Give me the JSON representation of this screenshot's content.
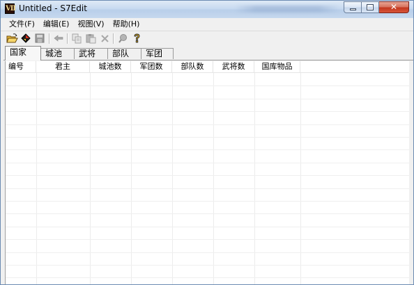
{
  "window": {
    "title": "Untitled - S7Edit",
    "app_icon_text": "VII",
    "close_glyph": "✕"
  },
  "menu": [
    {
      "label": "文件(F)"
    },
    {
      "label": "编辑(E)"
    },
    {
      "label": "视图(V)"
    },
    {
      "label": "帮助(H)"
    }
  ],
  "toolbar": {
    "buttons": [
      {
        "icon": "open-folder-icon",
        "enabled": true
      },
      {
        "icon": "diamond-tool-icon",
        "enabled": true
      },
      {
        "icon": "save-icon",
        "enabled": false
      },
      {
        "icon": "back-arrow-icon",
        "enabled": false
      },
      {
        "icon": "copy-icon",
        "enabled": false
      },
      {
        "icon": "paste-icon",
        "enabled": false
      },
      {
        "icon": "delete-icon",
        "enabled": false
      },
      {
        "icon": "search-icon",
        "enabled": false
      },
      {
        "icon": "help-icon",
        "enabled": true
      }
    ]
  },
  "tabs": [
    {
      "label": "国家",
      "active": true
    },
    {
      "label": "城池",
      "active": false
    },
    {
      "label": "武将",
      "active": false
    },
    {
      "label": "部队",
      "active": false
    },
    {
      "label": "军团",
      "active": false
    }
  ],
  "table": {
    "columns": [
      {
        "label": "编号"
      },
      {
        "label": "君主"
      },
      {
        "label": "城池数"
      },
      {
        "label": "军团数"
      },
      {
        "label": "部队数"
      },
      {
        "label": "武将数"
      },
      {
        "label": "国库物品"
      }
    ],
    "rows": []
  },
  "colors": {
    "titlebar": "#c8daf0",
    "close_button": "#c4381f",
    "window_bg": "#f0f0f0",
    "list_bg": "#ffffff"
  }
}
